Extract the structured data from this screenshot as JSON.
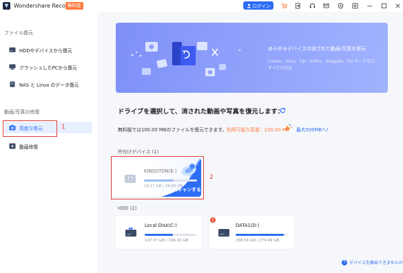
{
  "app": {
    "title": "Wondershare Recoverit",
    "badge": "無料版",
    "login_label": "ログイン",
    "toolbar_icons": [
      "cart-icon",
      "sign-in-icon",
      "headset-icon",
      "mail-icon",
      "shield-icon",
      "menu-icon",
      "minimize-icon",
      "maximize-icon",
      "close-icon"
    ]
  },
  "sidebar": {
    "section1": "ファイル復元",
    "items1": [
      {
        "label": "HDDやデバイスから復元",
        "icon": "hdd-icon"
      },
      {
        "label": "クラッシュしたPCから復元",
        "icon": "monitor-icon"
      },
      {
        "label": "NAS と Linux のデータ復元",
        "icon": "nas-icon"
      }
    ],
    "section2": "動画/写真の修復",
    "items2": [
      {
        "label": "高度な復元",
        "icon": "camera-icon",
        "active": true
      },
      {
        "label": "動画修復",
        "icon": "video-repair-icon"
      }
    ]
  },
  "annotations": {
    "one": "1",
    "two": "2"
  },
  "banner": {
    "title": "あらゆるデバイスの消された動画/写真を復元",
    "subtitle": "Canon、Sony、DJI、GoPro、Seagate、SD カードなど、すべてが対応"
  },
  "main": {
    "heading": "ドライブを選択して、消された動画や写真を復元します：",
    "free_prefix": "無料版では100.00 MBのファイルを復元できます。",
    "free_available": "利用可能な容量：100.00 MB",
    "upgrade_link": "最大500MBへ！",
    "external_label": "外付けデバイス (1)",
    "hdd_label": "HDD (2)",
    "help_link": "デバイスを検出できませんか？"
  },
  "drives": {
    "usb": {
      "name": "KINGSTON(E:)",
      "size": "16.17 GB / 28.82 GB",
      "used_fraction": 0.56,
      "scan_label": "スキャンする"
    },
    "local": {
      "name": "Local Disk(C:)",
      "size": "107.37 GB / 199.43 GB",
      "used_fraction": 0.54
    },
    "data1": {
      "name": "DATA1(D:)",
      "size": "258.56 GB / 279.49 GB",
      "used_fraction": 0.93
    }
  },
  "colors": {
    "accent": "#2d6df6",
    "badge": "#ff7a3c",
    "annotation": "#e23b3b",
    "warning": "#e8563a"
  }
}
